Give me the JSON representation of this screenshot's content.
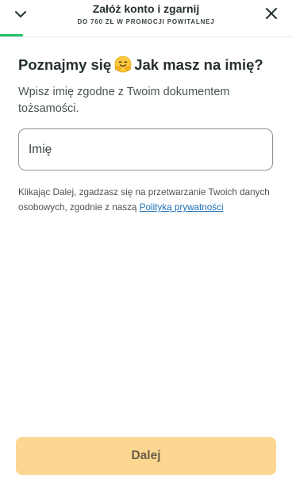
{
  "header": {
    "title": "Załóż konto i zgarnij",
    "subtitle": "DO 760 ZŁ W PROMOCJI POWITALNEJ",
    "back_icon": "chevron-down-icon",
    "close_icon": "close-icon"
  },
  "progress": {
    "fraction": 0.08,
    "color": "#1fc16b"
  },
  "form": {
    "headline_part1": "Poznajmy się",
    "headline_emoji": "hugging-face-emoji",
    "headline_part2": "Jak masz na imię?",
    "instruction": "Wpisz imię zgodne z Twoim dokumentem tożsamości.",
    "name_placeholder": "Imię",
    "name_value": "",
    "consent_text": "Klikając Dalej, zgadzasz się na przetwarzanie Twoich danych osobowych, zgodnie z naszą ",
    "consent_link": "Polityką prywatności"
  },
  "actions": {
    "next_label": "Dalej",
    "next_button_color": "#fcd792"
  },
  "colors": {
    "text_primary": "#253031",
    "link": "#1d6fb8"
  }
}
